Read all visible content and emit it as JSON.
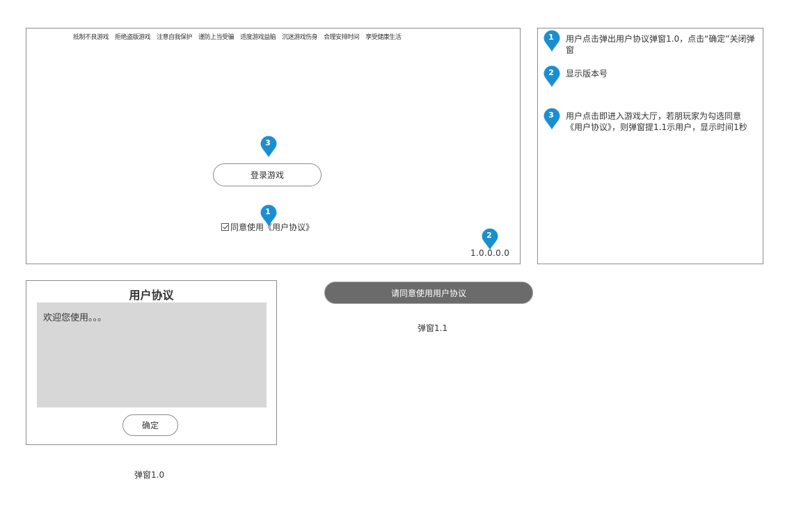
{
  "main": {
    "slogans": [
      "抵制不良游戏",
      "拒绝盗版游戏",
      "注意自我保护",
      "谨防上当受骗",
      "适度游戏益脑",
      "沉迷游戏伤身",
      "合理安排时间",
      "享受健康生活"
    ],
    "login_button": "登录游戏",
    "agree_text": "同意使用",
    "agreement_link": "《用户协议》",
    "agree_checked": true,
    "version": "1.0.0.0.0"
  },
  "markers": {
    "one": "1",
    "two": "2",
    "three": "3"
  },
  "notes": [
    {
      "num": "1",
      "text": "用户点击弹出用户协议弹窗1.0，点击“确定”关闭弹窗"
    },
    {
      "num": "2",
      "text": "显示版本号"
    },
    {
      "num": "3",
      "text": "用户点击即进入游戏大厅，若朋玩家为勾选同意《用户协议》，则弹窗提1.1示用户，显示时间1秒"
    }
  ],
  "popup_1_0": {
    "title": "用户协议",
    "body": "欢迎您使用。。。",
    "confirm": "确定",
    "caption": "弹窗1.0"
  },
  "popup_1_1": {
    "toast": "请同意使用用户协议",
    "caption": "弹窗1.1"
  },
  "colors": {
    "marker": "#1a8fd0",
    "toast_bg": "#6b6b6b",
    "agreement_body": "#d7d7d7",
    "border": "#8c8c8c"
  }
}
